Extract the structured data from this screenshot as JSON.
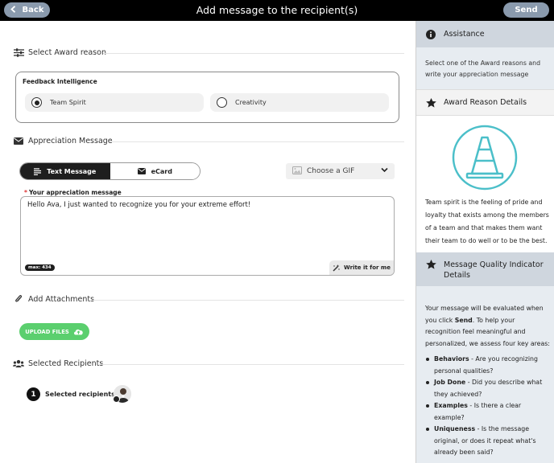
{
  "header": {
    "back_label": "Back",
    "title": "Add message to the recipient(s)",
    "send_label": "Send"
  },
  "award_reason": {
    "section_title": "Select Award reason",
    "group_label": "Feedback Intelligence",
    "options": [
      {
        "label": "Team Spirit",
        "selected": true
      },
      {
        "label": "Creativity",
        "selected": false
      }
    ]
  },
  "appreciation": {
    "section_title": "Appreciation Message",
    "tabs": [
      {
        "label": "Text Message",
        "active": true,
        "icon": "text-lines-icon"
      },
      {
        "label": "eCard",
        "active": false,
        "icon": "envelope-icon"
      }
    ],
    "gif_placeholder": "Choose a GIF",
    "message_label": "Your appreciation message",
    "required_marker": "*",
    "message_value": "Hello Ava, I just wanted to recognize you for your extreme effort!",
    "max_badge": "max: 434",
    "write_for_me_label": "Write it for me"
  },
  "attachments": {
    "section_title": "Add Attachments",
    "upload_label": "UPLOAD FILES"
  },
  "recipients": {
    "section_title": "Selected Recipients",
    "count": "1",
    "label": "Selected recipients"
  },
  "side": {
    "assistance_title": "Assistance",
    "assistance_text": "Select one of the Award reasons and write your appreciation message",
    "award_details_title": "Award Reason Details",
    "award_details_text": "Team spirit is the feeling of pride and loyalty that exists among the members of a team and that makes them want their team to do well or to be the best.",
    "quality_title": "Message Quality Indicator Details",
    "quality_intro_1": "Your message will be evaluated when you click ",
    "quality_intro_bold": "Send",
    "quality_intro_2": ". To help your recognition feel meaningful and personalized, we assess four key areas:",
    "quality_items": [
      {
        "term": "Behaviors",
        "desc": " - Are you recognizing personal qualities?"
      },
      {
        "term": "Job Done",
        "desc": " - Did you describe what they achieved?"
      },
      {
        "term": "Examples",
        "desc": " - Is there a clear example?"
      },
      {
        "term": "Uniqueness",
        "desc": " - Is the message original, or does it repeat what's already been said?"
      }
    ]
  },
  "colors": {
    "header_bg": "#000000",
    "header_button": "#8a9aad",
    "upload_green": "#5bcf6e",
    "cone_teal": "#4bbfc9",
    "side_header": "#cfd6de",
    "side_body": "#e7ecf1"
  }
}
